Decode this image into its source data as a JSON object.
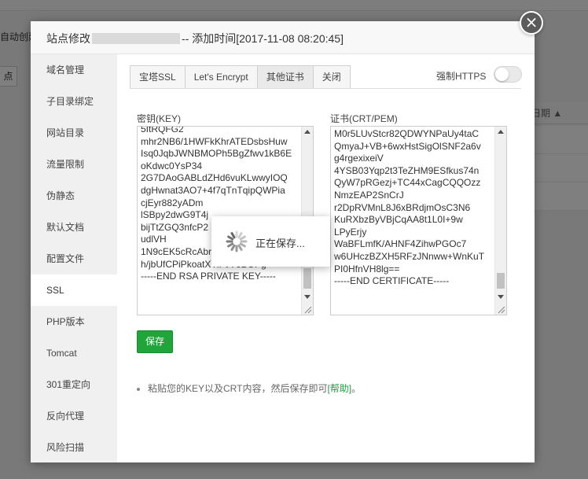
{
  "background": {
    "auto_label": "自动创建",
    "dot_button": "点",
    "date_column": "日期 ▲"
  },
  "modal": {
    "title_prefix": "站点修改",
    "title_suffix": "-- 添加时间[2017-11-08 08:20:45]",
    "close_symbol": "×"
  },
  "sidebar": {
    "items": [
      {
        "label": "域名管理",
        "active": false
      },
      {
        "label": "子目录绑定",
        "active": false
      },
      {
        "label": "网站目录",
        "active": false
      },
      {
        "label": "流量限制",
        "active": false
      },
      {
        "label": "伪静态",
        "active": false
      },
      {
        "label": "默认文档",
        "active": false
      },
      {
        "label": "配置文件",
        "active": false
      },
      {
        "label": "SSL",
        "active": true
      },
      {
        "label": "PHP版本",
        "active": false
      },
      {
        "label": "Tomcat",
        "active": false
      },
      {
        "label": "301重定向",
        "active": false
      },
      {
        "label": "反向代理",
        "active": false
      },
      {
        "label": "风险扫描",
        "active": false
      }
    ]
  },
  "tabs": [
    {
      "label": "宝塔SSL",
      "active": false
    },
    {
      "label": "Let's Encrypt",
      "active": false
    },
    {
      "label": "其他证书",
      "active": true
    },
    {
      "label": "关闭",
      "active": false
    }
  ],
  "force_https": {
    "label": "强制HTTPS",
    "enabled": false
  },
  "key_field": {
    "label": "密钥(KEY)",
    "text": "5ItRQFG2\nmhr2NB6/1HWFkKhrATEDsbsHuw\nIsq0JqbJWNBMOPh5BgZfwv1kB6E\noKdwc0YsP34\n2G7DAoGABLdZHd6vuKLwwyIOQ\ndgHwnat3AO7+4f7qTnTqipQWPia\ncjEyr882yADm\nlSBpy2dwG9T4j\nbijTtZGQ3nfcP2\nudlVH\n1N9cEK5cRcAbrYSqBGtXHgmWiA\nh/jbUfCPiPkoatXYiFvY6BOPg=\n-----END RSA PRIVATE KEY-----",
    "scroll_position": 0.97
  },
  "cert_field": {
    "label": "证书(CRT/PEM)",
    "text": "M0r5LUvStcr82QDWYNPaUy4taC\nQmyaJ+VB+6wxHstSigOlSNF2a6v\ng4rgexixeiV\n4YSB03Yqp2t3TeZHM9ESfkus74n\nQyW7pRGezj+TC44xCagCQQOzz\nNmzEAP2SnCrJ\nr2DpRVMnL8J6xBRdjmOsC3N6\nKuRXbzByVBjCqAA8t1L0I+9w\nLPyErjy\nWaBFLmfK/AHNF4ZihwPGOc7\nw6UHczBZXH5RFzJNnww+WnKuT\nPI0HfnVH8lg==\n-----END CERTIFICATE-----",
    "scroll_position": 0.97
  },
  "save_button": "保存",
  "tip": {
    "text": "粘贴您的KEY以及CRT内容，然后保存即可",
    "link": "[帮助]",
    "end": "。"
  },
  "loading": {
    "text": "正在保存..."
  },
  "colors": {
    "accent_green": "#20a53a",
    "overlay": "#000000"
  }
}
